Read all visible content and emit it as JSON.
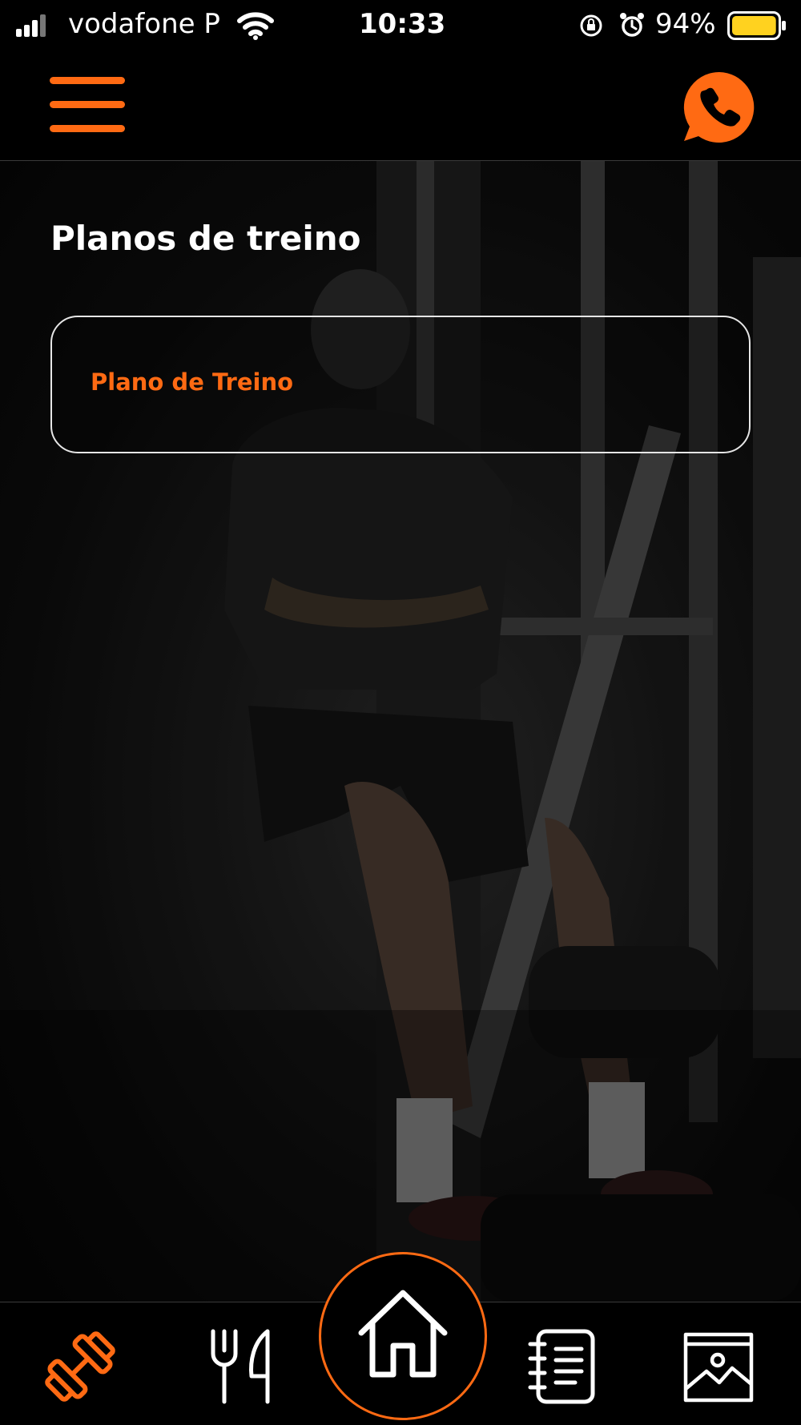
{
  "status_bar": {
    "carrier": "vodafone P",
    "time": "10:33",
    "battery_percent_label": "94%",
    "battery_level": 0.94,
    "icons": [
      "signal-icon",
      "wifi-icon",
      "orientation-lock-icon",
      "alarm-icon",
      "battery-icon"
    ]
  },
  "header": {
    "menu_icon": "hamburger-menu-icon",
    "call_icon": "phone-chat-icon",
    "accent_color": "#ff6a13"
  },
  "main": {
    "title": "Planos de treino",
    "plans": [
      {
        "label": "Plano de Treino"
      }
    ]
  },
  "bottom_nav": {
    "items": [
      {
        "icon": "dumbbell-icon",
        "active": true
      },
      {
        "icon": "fork-knife-icon",
        "active": false
      },
      {
        "icon": "home-icon",
        "active": false
      },
      {
        "icon": "notebook-icon",
        "active": false
      },
      {
        "icon": "gallery-icon",
        "active": false
      }
    ]
  }
}
